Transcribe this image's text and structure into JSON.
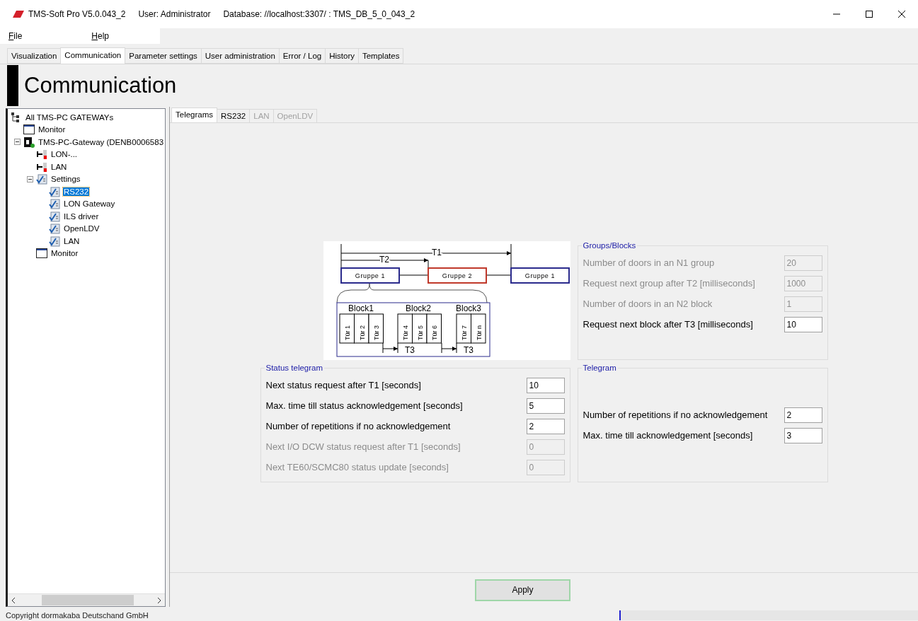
{
  "window": {
    "title": "TMS-Soft Pro V5.0.043_2",
    "user": "User: Administrator",
    "database": "Database: //localhost:3307/ : TMS_DB_5_0_043_2"
  },
  "menu": [
    "File",
    "Help"
  ],
  "tabs": [
    {
      "label": "Visualization",
      "selected": false
    },
    {
      "label": "Communication",
      "selected": true
    },
    {
      "label": "Parameter settings",
      "selected": false
    },
    {
      "label": "User administration",
      "selected": false
    },
    {
      "label": "Error / Log",
      "selected": false
    },
    {
      "label": "History",
      "selected": false
    },
    {
      "label": "Templates",
      "selected": false
    }
  ],
  "page_title": "Communication",
  "tree": [
    {
      "label": "All TMS-PC GATEWAYs",
      "kind": "network",
      "selected": false,
      "children": [
        {
          "label": "Monitor",
          "kind": "monitor",
          "selected": false
        },
        {
          "label": "TMS-PC-Gateway (DENB0006583",
          "kind": "gateway",
          "selected": false,
          "expanded": true,
          "children": [
            {
              "label": "LON-...",
              "kind": "plug",
              "selected": false
            },
            {
              "label": "LAN",
              "kind": "plug",
              "selected": false
            },
            {
              "label": "Settings",
              "kind": "settings",
              "selected": false,
              "expanded": true,
              "children": [
                {
                  "label": "RS232",
                  "kind": "settings",
                  "selected": true
                },
                {
                  "label": "LON Gateway",
                  "kind": "settings",
                  "selected": false
                },
                {
                  "label": "ILS driver",
                  "kind": "settings",
                  "selected": false
                },
                {
                  "label": "OpenLDV",
                  "kind": "settings",
                  "selected": false
                },
                {
                  "label": "LAN",
                  "kind": "settings",
                  "selected": false
                }
              ]
            },
            {
              "label": "Monitor",
              "kind": "monitor",
              "selected": false
            }
          ]
        }
      ]
    }
  ],
  "subtabs": [
    {
      "label": "Telegrams",
      "selected": true,
      "disabled": false
    },
    {
      "label": "RS232",
      "selected": false,
      "disabled": false
    },
    {
      "label": "LAN",
      "selected": false,
      "disabled": true
    },
    {
      "label": "OpenLDV",
      "selected": false,
      "disabled": true
    }
  ],
  "diagram": {
    "t1": "T1",
    "t2": "T2",
    "groups": [
      {
        "label": "Gruppe 1",
        "color": "#2b2b8c"
      },
      {
        "label": "Gruppe 2",
        "color": "#c0392b"
      },
      {
        "label": "Gruppe 1",
        "color": "#2b2b8c"
      }
    ],
    "blocks": [
      {
        "label": "Block1",
        "doors": [
          "Tür 1",
          "Tür 2",
          "Tür 3"
        ]
      },
      {
        "label": "Block2",
        "doors": [
          "Tür 4",
          "Tür 5",
          "Tür 6"
        ]
      },
      {
        "label": "Block3",
        "doors": [
          "Tür 7",
          "Tür n"
        ]
      }
    ],
    "t3": [
      "T3",
      "T3"
    ]
  },
  "groups_blocks": {
    "title": "Groups/Blocks",
    "fields": [
      {
        "label": "Number of doors in an N1 group",
        "value": "20",
        "disabled": true
      },
      {
        "label": "Request next group after T2 [milliseconds]",
        "value": "1000",
        "disabled": true
      },
      {
        "label": "Number of doors in an N2 block",
        "value": "1",
        "disabled": true
      },
      {
        "label": "Request next block after T3 [milliseconds]",
        "value": "10",
        "disabled": false
      }
    ]
  },
  "status_telegram": {
    "title": "Status telegram",
    "fields": [
      {
        "label": "Next status request after T1 [seconds]",
        "value": "10",
        "disabled": false
      },
      {
        "label": "Max. time till status acknowledgement [seconds]",
        "value": "5",
        "disabled": false
      },
      {
        "label": "Number of repetitions if no acknowledgement",
        "value": "2",
        "disabled": false
      },
      {
        "label": "Next I/O DCW status request after T1 [seconds]",
        "value": "0",
        "disabled": true
      },
      {
        "label": "Next TE60/SCMC80 status update [seconds]",
        "value": "0",
        "disabled": true
      }
    ]
  },
  "telegram": {
    "title": "Telegram",
    "fields": [
      {
        "label": "Number of repetitions if no acknowledgement",
        "value": "2",
        "disabled": false
      },
      {
        "label": "Max. time till acknowledgement [seconds]",
        "value": "3",
        "disabled": false
      }
    ]
  },
  "apply_button": "Apply",
  "status_bar": "Copyright dormakaba Deutschand GmbH"
}
